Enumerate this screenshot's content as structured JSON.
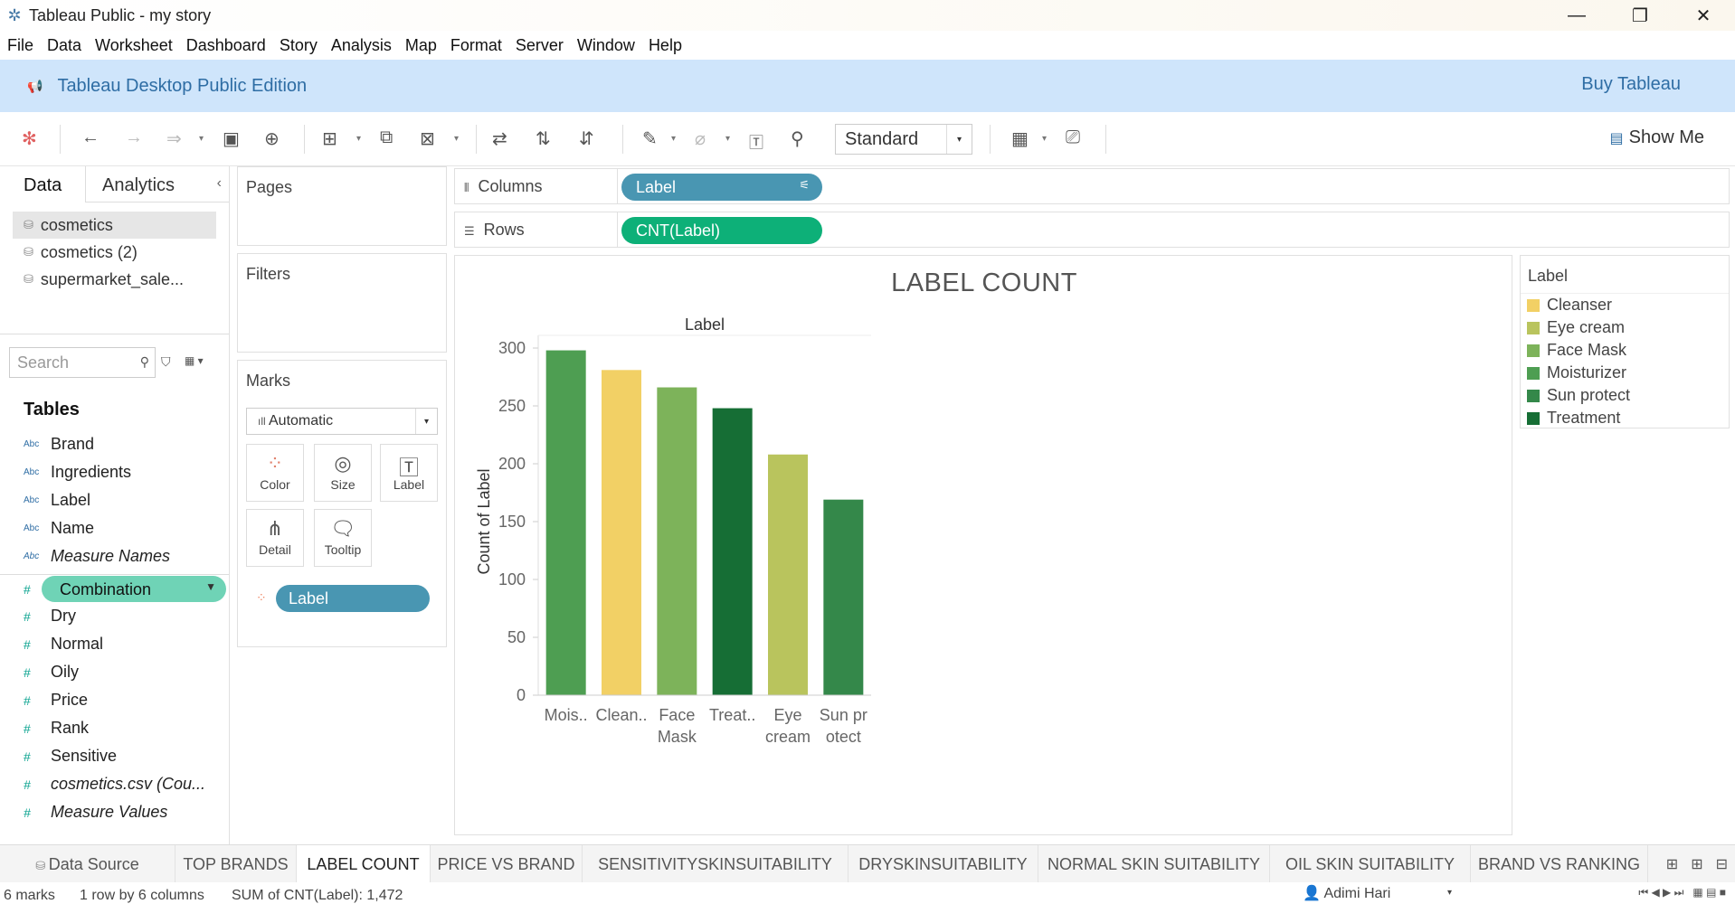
{
  "window": {
    "title": "Tableau Public - my story",
    "controls": {
      "minimize": "—",
      "restore": "❐",
      "close": "✕"
    }
  },
  "menu": [
    "File",
    "Data",
    "Worksheet",
    "Dashboard",
    "Story",
    "Analysis",
    "Map",
    "Format",
    "Server",
    "Window",
    "Help"
  ],
  "banner": {
    "edition": "Tableau Desktop Public Edition",
    "buy": "Buy Tableau"
  },
  "toolbar": {
    "fit": "Standard",
    "show_me": "Show Me"
  },
  "data_pane": {
    "tabs": [
      "Data",
      "Analytics"
    ],
    "datasources": [
      "cosmetics",
      "cosmetics (2)",
      "supermarket_sale..."
    ],
    "search_placeholder": "Search",
    "tables_heading": "Tables",
    "dimensions": [
      {
        "type": "Abc",
        "name": "Brand"
      },
      {
        "type": "Abc",
        "name": "Ingredients"
      },
      {
        "type": "Abc",
        "name": "Label"
      },
      {
        "type": "Abc",
        "name": "Name"
      },
      {
        "type": "Abc",
        "name": "Measure Names"
      }
    ],
    "measures": [
      {
        "type": "#",
        "name": "Combination"
      },
      {
        "type": "#",
        "name": "Dry"
      },
      {
        "type": "#",
        "name": "Normal"
      },
      {
        "type": "#",
        "name": "Oily"
      },
      {
        "type": "#",
        "name": "Price"
      },
      {
        "type": "#",
        "name": "Rank"
      },
      {
        "type": "#",
        "name": "Sensitive"
      },
      {
        "type": "#",
        "name": "cosmetics.csv (Cou..."
      },
      {
        "type": "#",
        "name": "Measure Values"
      }
    ]
  },
  "cards": {
    "pages": "Pages",
    "filters": "Filters",
    "marks": "Marks",
    "mark_type": "Automatic",
    "mark_buttons": [
      "Color",
      "Size",
      "Label",
      "Detail",
      "Tooltip"
    ],
    "mark_pill": "Label"
  },
  "shelves": {
    "columns_label": "Columns",
    "columns_pill": "Label",
    "rows_label": "Rows",
    "rows_pill": "CNT(Label)"
  },
  "view": {
    "title": "LABEL COUNT"
  },
  "chart_data": {
    "type": "bar",
    "title": "LABEL COUNT",
    "header": "Label",
    "ylabel": "Count of Label",
    "categories": [
      "Mois..",
      "Clean..",
      "Face Mask",
      "Treat..",
      "Eye cream",
      "Sun protect"
    ],
    "category_lines": [
      [
        "Mois.."
      ],
      [
        "Clean.."
      ],
      [
        "Face",
        "Mask"
      ],
      [
        "Treat.."
      ],
      [
        "Eye",
        "cream"
      ],
      [
        "Sun pr",
        "otect"
      ]
    ],
    "values": [
      298,
      281,
      266,
      248,
      208,
      169
    ],
    "colors": [
      "#4e9e52",
      "#f2d065",
      "#7db35a",
      "#166e35",
      "#b9c45d",
      "#34884a"
    ],
    "yticks": [
      0,
      50,
      100,
      150,
      200,
      250,
      300
    ],
    "ylim": [
      0,
      300
    ]
  },
  "legend": {
    "title": "Label",
    "items": [
      {
        "name": "Cleanser",
        "color": "#f2d065"
      },
      {
        "name": "Eye cream",
        "color": "#b9c45d"
      },
      {
        "name": "Face Mask",
        "color": "#7db35a"
      },
      {
        "name": "Moisturizer",
        "color": "#4e9e52"
      },
      {
        "name": "Sun protect",
        "color": "#34884a"
      },
      {
        "name": "Treatment",
        "color": "#166e35"
      }
    ]
  },
  "sheet_tabs": [
    "Data Source",
    "TOP BRANDS",
    "LABEL COUNT",
    "PRICE VS BRAND",
    "SENSITIVITYSKINSUITABILITY",
    "DRYSKINSUITABILITY",
    "NORMAL SKIN SUITABILITY",
    "OIL SKIN SUITABILITY",
    "BRAND VS RANKING"
  ],
  "status": {
    "marks": "6 marks",
    "dims": "1 row by 6 columns",
    "sum": "SUM of CNT(Label): 1,472",
    "user": "Adimi Hari"
  }
}
